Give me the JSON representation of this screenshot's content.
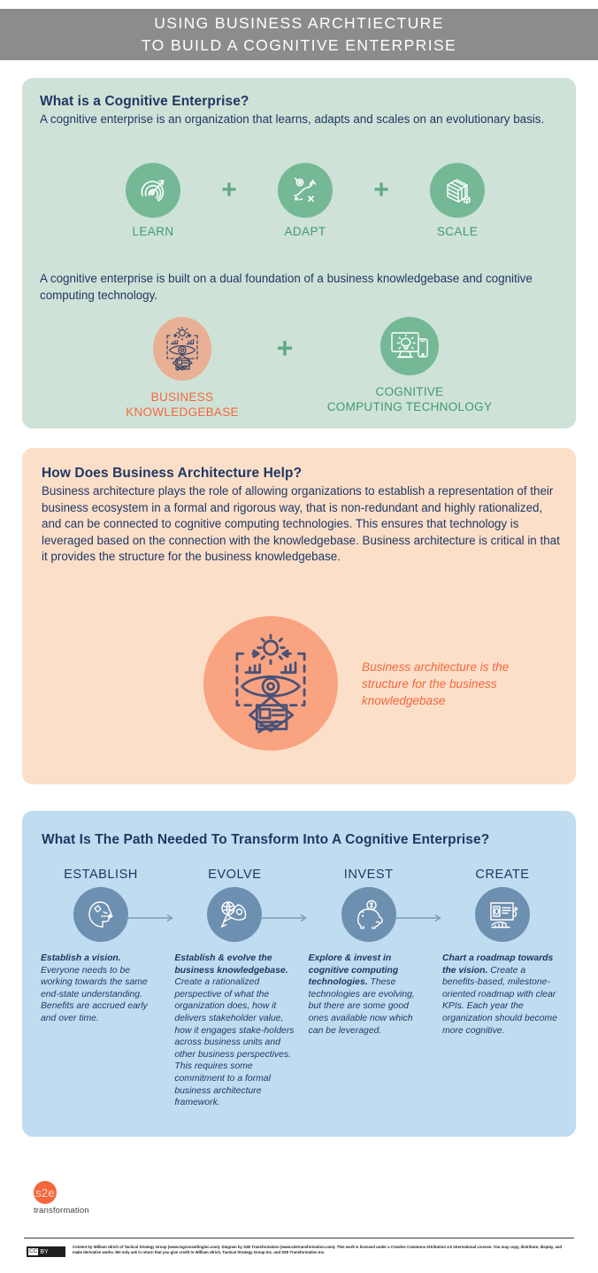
{
  "header": {
    "line1": "USING BUSINESS ARCHTIECTURE",
    "line2": "TO BUILD A COGNITIVE ENTERPRISE",
    "bg_color": "#8c8c8c"
  },
  "colors": {
    "green_panel": "#cfe2d7",
    "green_circle": "#74b896",
    "green_text": "#3f9b6d",
    "orange_panel": "#fcdfc9",
    "orange_circle": "#f9a380",
    "salmon_circle": "#e8b094",
    "orange_text": "#f4673c",
    "blue_panel": "#bfdcf0",
    "blue_circle": "#6e90b0",
    "navy_text": "#1f3864"
  },
  "green_section": {
    "heading": "What is a Cognitive Enterprise?",
    "intro": "A cognitive enterprise is an organization that learns, adapts and scales on an evolutionary basis.",
    "trio": [
      {
        "label": "LEARN",
        "icon": "target-maze-arrow-icon"
      },
      {
        "label": "ADAPT",
        "icon": "winding-path-arrow-icon"
      },
      {
        "label": "SCALE",
        "icon": "cube-grid-icon"
      }
    ],
    "plus_symbol": "+",
    "subtext": "A cognitive enterprise is built on a dual foundation of a business knowledgebase and cognitive computing technology.",
    "duo": [
      {
        "label_line1": "BUSINESS",
        "label_line2": "KNOWLEDGEBASE",
        "icon": "eye-knowledgebase-icon",
        "color": "#f4673c"
      },
      {
        "label_line1": "COGNITIVE",
        "label_line2": "COMPUTING TECHNOLOGY",
        "icon": "monitor-mobile-brain-icon",
        "color": "#3f9b6d"
      }
    ]
  },
  "orange_section": {
    "heading": "How Does Business Architecture Help?",
    "body": "Business architecture plays the role of allowing organizations to establish a representation of their business ecosystem in a formal and rigorous way, that is non-redundant and highly rationalized, and can be connected to cognitive computing technologies. This ensures that technology is leveraged based on the connection with the knowledgebase. Business architecture is critical in that it provides the structure for the business knowledgebase.",
    "figure_icon": "eye-knowledgebase-icon",
    "caption": "Business architecture is the structure for the business knowledgebase"
  },
  "blue_section": {
    "heading": "What Is The Path Needed To Transform Into A Cognitive Enterprise?",
    "steps": [
      {
        "label": "ESTABLISH",
        "icon": "head-vision-arrow-icon",
        "lead": "Establish a vision.",
        "body": " Everyone needs to be working towards the same end-state understanding. Benefits are accrued early and over time."
      },
      {
        "label": "EVOLVE",
        "icon": "rocket-globe-icon",
        "lead": "Establish & evolve the business knowledgebase.",
        "body": " Create a rationalized perspective of what the organization does, how it delivers stakeholder value, how it engages stake-holders across business units and other business perspectives. This requires some commitment to a formal business architecture framework."
      },
      {
        "label": "INVEST",
        "icon": "piggy-bank-icon",
        "lead": "Explore & invest in cognitive computing technologies.",
        "body": " These technologies are evolving, but there are some good ones available now which can be leveraged."
      },
      {
        "label": "CREATE",
        "icon": "presentation-board-icon",
        "lead": "Chart a roadmap towards the vision.",
        "body": " Create a benefits-based, milestone-oriented roadmap with clear KPIs. Each year the organization should become more cognitive."
      }
    ]
  },
  "footer": {
    "logo_mark": "s2e",
    "logo_word": "transformation",
    "cc_badge_label": "BY",
    "cc_badge_mark": "CC",
    "credit": "Content by William Ulrich of Tactical Strategy Group (www.tsgconsultinginc.com). Diagram by S2E Transformation (www.s2etransformation.com). This work is licensed under a Creative Commons Attribution 4.0 International License. You may copy, distribute, display, and make derivative works. We only ask in return that you give credit to William Ulrich, Tactical Strategy Group Inc. and S2E Transformation Inc."
  }
}
